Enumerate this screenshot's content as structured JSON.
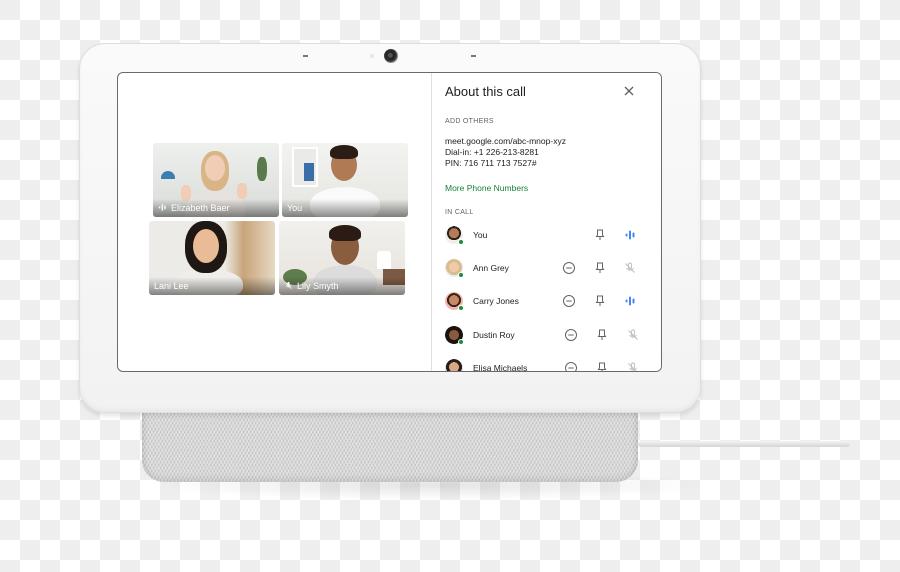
{
  "device": "smart-display",
  "call_grid": {
    "tiles": [
      {
        "name": "Elizabeth Baer",
        "audio": "speaking"
      },
      {
        "name": "You",
        "audio": "none"
      },
      {
        "name": "Lani Lee",
        "audio": "none"
      },
      {
        "name": "Lily Smyth",
        "audio": "muted"
      }
    ]
  },
  "panel": {
    "title": "About this call",
    "close_icon": "close-icon",
    "add_others_heading": "ADD OTHERS",
    "meeting_link": "meet.google.com/abc-mnop-xyz",
    "dial_in_label": "Dial-in:",
    "dial_in_number": "+1 226-213-8281",
    "pin_label": "PIN:",
    "pin_value": "716 711 713 7527#",
    "more_numbers_link": "More Phone Numbers",
    "in_call_heading": "IN CALL",
    "participants": [
      {
        "name": "You",
        "removable": false,
        "audio": "speaking"
      },
      {
        "name": "Ann Grey",
        "removable": true,
        "audio": "muted"
      },
      {
        "name": "Carry Jones",
        "removable": true,
        "audio": "speaking"
      },
      {
        "name": "Dustin Roy",
        "removable": true,
        "audio": "muted"
      },
      {
        "name": "Elisa Michaels",
        "removable": true,
        "audio": "muted"
      }
    ]
  },
  "colors": {
    "accent_green": "#188038",
    "online_dot": "#1e8e3e",
    "speaking_blue": "#4285f4",
    "muted_gray": "#bdbdbd"
  }
}
